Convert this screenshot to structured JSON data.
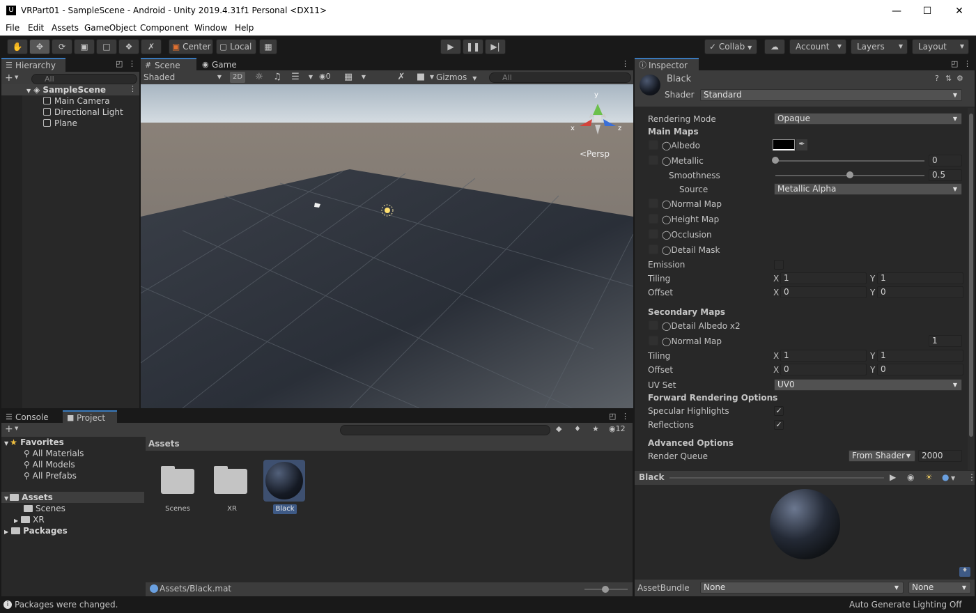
{
  "window": {
    "title": "VRPart01 - SampleScene - Android - Unity 2019.4.31f1 Personal <DX11>",
    "logo_text": "U"
  },
  "menu": [
    "File",
    "Edit",
    "Assets",
    "GameObject",
    "Component",
    "Window",
    "Help"
  ],
  "toolbar": {
    "pivot_label": "Center",
    "space_label": "Local",
    "collab_label": "Collab",
    "account_label": "Account",
    "layers_label": "Layers",
    "layout_label": "Layout"
  },
  "hierarchy": {
    "tab": "Hierarchy",
    "search_placeholder": "All",
    "scene": "SampleScene",
    "items": [
      "Main Camera",
      "Directional Light",
      "Plane"
    ]
  },
  "scene_view": {
    "tab_scene": "Scene",
    "tab_game": "Game",
    "shading": "Shaded",
    "mode_2d": "2D",
    "hidden_count": "0",
    "gizmos": "Gizmos",
    "search_placeholder": "All",
    "persp": "<Persp",
    "axis_x": "x",
    "axis_y": "y",
    "axis_z": "z"
  },
  "inspector": {
    "tab": "Inspector",
    "material_name": "Black",
    "shader_label": "Shader",
    "shader_value": "Standard",
    "rendering_mode_label": "Rendering Mode",
    "rendering_mode_value": "Opaque",
    "main_maps": "Main Maps",
    "albedo": "Albedo",
    "albedo_color": "#000000",
    "metallic": "Metallic",
    "metallic_value": "0",
    "metallic_level": 0,
    "smoothness": "Smoothness",
    "smoothness_value": "0.5",
    "smoothness_level": 0.5,
    "source": "Source",
    "source_value": "Metallic Alpha",
    "normal_map": "Normal Map",
    "height_map": "Height Map",
    "occlusion": "Occlusion",
    "detail_mask": "Detail Mask",
    "emission": "Emission",
    "tiling": "Tiling",
    "offset": "Offset",
    "x": "X",
    "y": "Y",
    "tiling_x": "1",
    "tiling_y": "1",
    "offset_x": "0",
    "offset_y": "0",
    "secondary_maps": "Secondary Maps",
    "detail_albedo": "Detail Albedo x2",
    "normal_map2": "Normal Map",
    "normal_map2_value": "1",
    "tiling2_x": "1",
    "tiling2_y": "1",
    "offset2_x": "0",
    "offset2_y": "0",
    "uv_set": "UV Set",
    "uv_set_value": "UV0",
    "forward_options": "Forward Rendering Options",
    "specular_highlights": "Specular Highlights",
    "reflections": "Reflections",
    "advanced_options": "Advanced Options",
    "render_queue": "Render Queue",
    "render_queue_source": "From Shader",
    "render_queue_value": "2000",
    "preview_title": "Black",
    "assetbundle_label": "AssetBundle",
    "assetbundle_value": "None",
    "assetbundle_variant": "None"
  },
  "project": {
    "tab_console": "Console",
    "tab_project": "Project",
    "hidden_count": "12",
    "favorites": "Favorites",
    "fav_items": [
      "All Materials",
      "All Models",
      "All Prefabs"
    ],
    "assets_root": "Assets",
    "asset_folders": [
      "Scenes",
      "XR"
    ],
    "packages": "Packages",
    "breadcrumb": "Assets",
    "grid_items": [
      "Scenes",
      "XR",
      "Black"
    ],
    "selected_path": "Assets/Black.mat"
  },
  "status": {
    "message": "Packages were changed.",
    "lighting": "Auto Generate Lighting Off"
  }
}
